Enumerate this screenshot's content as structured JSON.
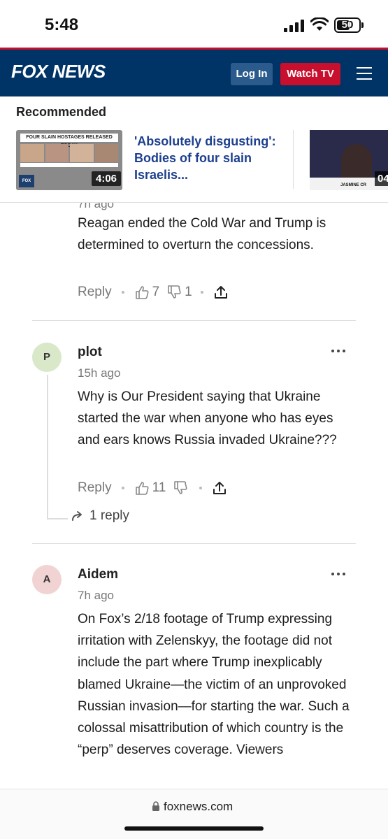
{
  "status": {
    "time": "5:48",
    "battery": "50"
  },
  "header": {
    "logo": "FOX NEWS",
    "login_label": "Log In",
    "watch_label": "Watch TV"
  },
  "recommended": {
    "title": "Recommended",
    "card1": {
      "banner": "FOUR SLAIN HOSTAGES RELEASED TODAY",
      "duration": "4:06",
      "headline": "'Absolutely disgusting': Bodies of four slain Israelis..."
    },
    "card2": {
      "duration": "04",
      "chyron": "JASMINE CR"
    }
  },
  "comments": [
    {
      "age": "7h ago",
      "body": "Reagan ended the Cold War and Trump is determined to overturn the concessions.",
      "reply_label": "Reply",
      "likes": "7",
      "dislikes": "1"
    },
    {
      "avatar_letter": "P",
      "avatar_color": "#d9e8c9",
      "author": "plot",
      "age": "15h ago",
      "body": "Why is Our President saying that Ukraine started the war when anyone who has eyes and ears knows Russia invaded Ukraine???",
      "reply_label": "Reply",
      "likes": "11",
      "dislikes": "",
      "replies_label": "1 reply"
    },
    {
      "avatar_letter": "A",
      "avatar_color": "#f2d3d3",
      "author": "Aidem",
      "age": "7h ago",
      "body": "On Fox’s 2/18 footage of Trump expressing irritation with Zelenskyy, the footage did not include the part where Trump inexplicably blamed Ukraine—the victim of an unprovoked Russian invasion—for starting the war. Such a colossal misattribution of which country is the “perp” deserves coverage. Viewers"
    }
  ],
  "urlbar": {
    "url": "foxnews.com"
  }
}
